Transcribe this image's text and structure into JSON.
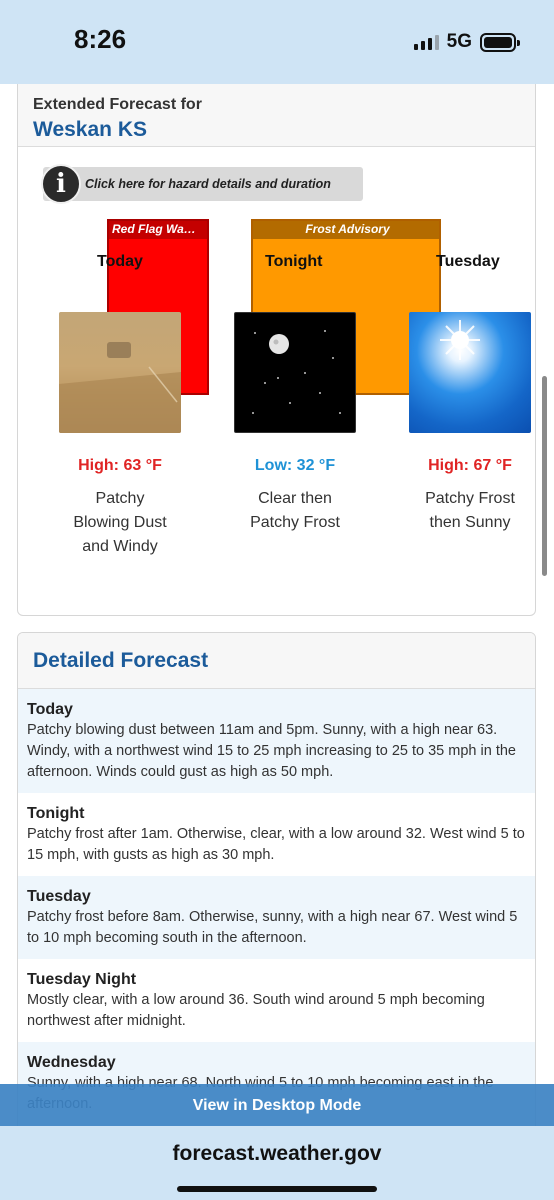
{
  "status_bar": {
    "time": "8:26",
    "network": "5G"
  },
  "extended_forecast": {
    "label": "Extended Forecast for",
    "location": "Weskan KS",
    "hazard_link": "Click here for hazard details and duration",
    "hazards": [
      {
        "label": "Red Flag Wa…",
        "color": "#ff0000"
      },
      {
        "label": "Frost Advisory",
        "color": "#ff9900"
      }
    ],
    "periods": [
      {
        "name": "Today",
        "temp": "High: 63 °F",
        "temp_type": "high",
        "desc_lines": [
          "Patchy",
          "Blowing Dust",
          "and Windy"
        ],
        "icon": "blowing-dust-image"
      },
      {
        "name": "Tonight",
        "temp": "Low: 32 °F",
        "temp_type": "low",
        "desc_lines": [
          "Clear then",
          "Patchy Frost"
        ],
        "icon": "clear-night-moon-image"
      },
      {
        "name": "Tuesday",
        "temp": "High: 67 °F",
        "temp_type": "high",
        "desc_lines": [
          "Patchy Frost",
          "then Sunny"
        ],
        "icon": "sunny-image"
      }
    ]
  },
  "detailed_forecast": {
    "title": "Detailed Forecast",
    "rows": [
      {
        "name": "Today",
        "text": "Patchy blowing dust between 11am and 5pm. Sunny, with a high near 63. Windy, with a northwest wind 15 to 25 mph increasing to 25 to 35 mph in the afternoon. Winds could gust as high as 50 mph."
      },
      {
        "name": "Tonight",
        "text": "Patchy frost after 1am. Otherwise, clear, with a low around 32. West wind 5 to 15 mph, with gusts as high as 30 mph."
      },
      {
        "name": "Tuesday",
        "text": "Patchy frost before 8am. Otherwise, sunny, with a high near 67. West wind 5 to 10 mph becoming south in the afternoon."
      },
      {
        "name": "Tuesday Night",
        "text": "Mostly clear, with a low around 36. South wind around 5 mph becoming northwest after midnight."
      },
      {
        "name": "Wednesday",
        "text": "Sunny, with a high near 68. North wind 5 to 10 mph becoming east in the afternoon."
      }
    ]
  },
  "desktop_mode_label": "View in Desktop Mode",
  "address_bar": {
    "domain": "forecast.weather.gov"
  }
}
